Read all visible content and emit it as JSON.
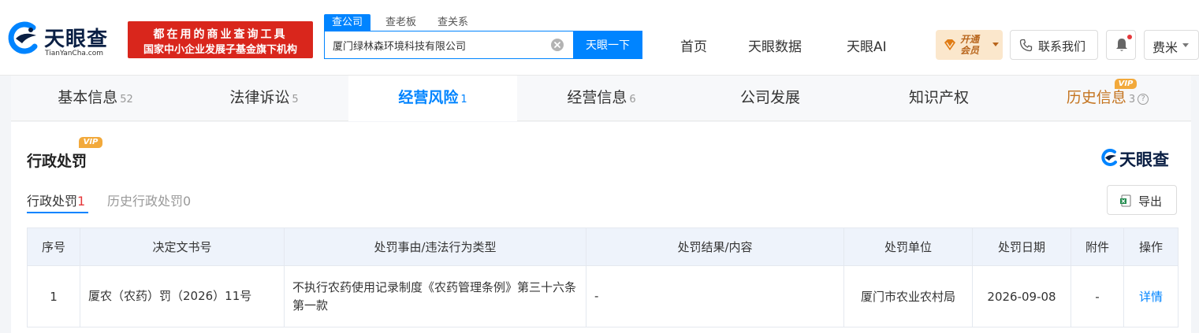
{
  "brand": {
    "name": "天眼查",
    "domain": "TianYanCha.com",
    "banner_line1": "都在用的商业查询工具",
    "banner_line2": "国家中小企业发展子基金旗下机构",
    "accent": "#0084ff"
  },
  "search": {
    "tabs": [
      "查公司",
      "查老板",
      "查关系"
    ],
    "value": "厦门绿林森环境科技有限公司",
    "button": "天眼一下"
  },
  "nav": {
    "links": [
      "首页",
      "天眼数据",
      "天眼AI"
    ],
    "vip_line1": "开通",
    "vip_line2": "会员",
    "contact": "联系我们",
    "user": "费米"
  },
  "tabs": [
    {
      "label": "基本信息",
      "count": "52"
    },
    {
      "label": "法律诉讼",
      "count": "5"
    },
    {
      "label": "经营风险",
      "count": "1"
    },
    {
      "label": "经营信息",
      "count": "6"
    },
    {
      "label": "公司发展",
      "count": ""
    },
    {
      "label": "知识产权",
      "count": ""
    },
    {
      "label": "历史信息",
      "count": "3",
      "badge": "VIP",
      "help": "?"
    }
  ],
  "section": {
    "title": "行政处罚",
    "badge": "VIP",
    "watermark": "天眼查",
    "subtabs": [
      {
        "label": "行政处罚",
        "count": "1"
      },
      {
        "label": "历史行政处罚",
        "count": "0"
      }
    ],
    "export": "导出"
  },
  "table": {
    "headers": [
      "序号",
      "决定文书号",
      "处罚事由/违法行为类型",
      "处罚结果/内容",
      "处罚单位",
      "处罚日期",
      "附件",
      "操作"
    ],
    "rows": [
      {
        "index": "1",
        "doc_no": "厦农（农药）罚（2026）11号",
        "reason": "不执行农药使用记录制度《农药管理条例》第三十六条第一款",
        "result": "-",
        "unit": "厦门市农业农村局",
        "date": "2026-09-08",
        "attachment": "-",
        "action": "详情"
      }
    ]
  }
}
